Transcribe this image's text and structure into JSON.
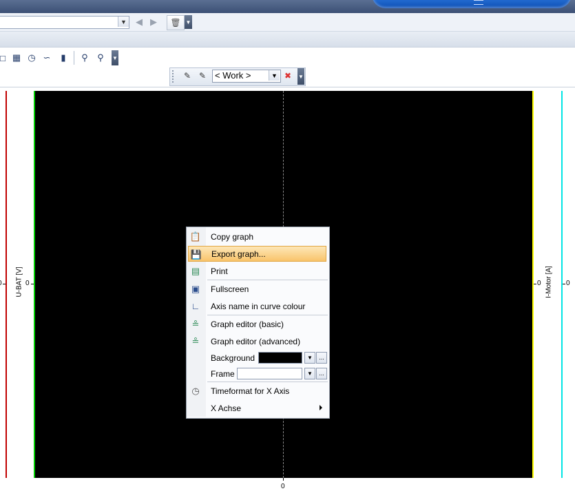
{
  "toolbar": {
    "work_combo": "< Work >"
  },
  "graph": {
    "background_color": "#000000",
    "left_axis_label": "U-BAT [V]",
    "right_axis_label": "I-Motor [A]",
    "left_outer_tick": "0",
    "left_inner_tick": "0",
    "right_inner_tick": "0",
    "right_outer_tick": "0",
    "x_tick": "0",
    "axis_colors": {
      "u_bat_outer": "#c00000",
      "u_bat_inner": "#00d000",
      "i_motor_inner": "#ffff00",
      "i_motor_outer": "#00e5e5"
    }
  },
  "context_menu": {
    "items": [
      {
        "label": "Copy graph",
        "icon": "copy-graph-icon"
      },
      {
        "label": "Export graph...",
        "icon": "export-graph-icon",
        "highlighted": true
      },
      {
        "label": "Print",
        "icon": "print-icon"
      },
      {
        "label": "Fullscreen",
        "icon": "fullscreen-icon"
      },
      {
        "label": "Axis name in curve colour",
        "icon": "axis-colour-icon"
      },
      {
        "label": "Graph editor (basic)",
        "icon": "graph-editor-basic-icon"
      },
      {
        "label": "Graph editor (advanced)",
        "icon": "graph-editor-advanced-icon"
      },
      {
        "label": "Background",
        "value_color": "#000000"
      },
      {
        "label": "Frame",
        "value_color": "#ffffff"
      },
      {
        "label": "Timeformat for X Axis",
        "icon": "timeformat-icon"
      },
      {
        "label": "X Achse",
        "has_submenu": true
      }
    ],
    "more_button": "..."
  }
}
